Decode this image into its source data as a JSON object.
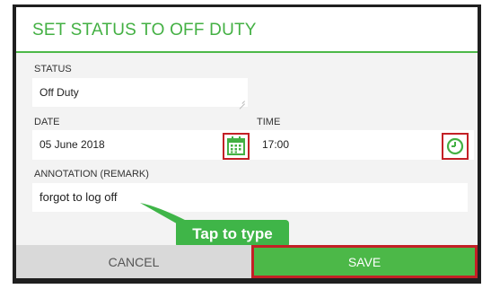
{
  "dialog": {
    "title": "SET STATUS TO OFF DUTY"
  },
  "status": {
    "label": "STATUS",
    "value": "Off Duty"
  },
  "date": {
    "label": "DATE",
    "value": "05 June 2018",
    "icon": "calendar-icon"
  },
  "time": {
    "label": "TIME",
    "value": "17:00",
    "icon": "clock-icon"
  },
  "annotation": {
    "label": "ANNOTATION (REMARK)",
    "value": "forgot to log off"
  },
  "tooltip": {
    "text": "Tap to type"
  },
  "footer": {
    "cancel_label": "CANCEL",
    "save_label": "SAVE"
  },
  "colors": {
    "accent_green": "#4cb848",
    "highlight_red": "#c32026"
  }
}
